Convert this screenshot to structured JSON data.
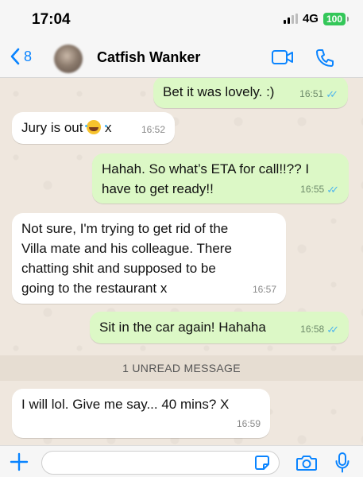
{
  "status_bar": {
    "time": "17:04",
    "network": "4G",
    "battery": "100"
  },
  "header": {
    "back_count": "8",
    "contact_name": "Catfish Wanker"
  },
  "messages": [
    {
      "direction": "out",
      "text": "Bet it was lovely. :)",
      "time": "16:51",
      "read": true
    },
    {
      "direction": "in",
      "text": "Jury is out",
      "emoji": "laughing-emoji",
      "suffix": "x",
      "time": "16:52"
    },
    {
      "direction": "out",
      "lines": [
        "Hahah. So what’s ETA for call!!?? I",
        "have to get ready!!"
      ],
      "time": "16:55",
      "read": true
    },
    {
      "direction": "in",
      "lines": [
        "Not sure, I'm trying to get rid of the",
        "Villa mate and his colleague. There",
        "chatting shit and supposed to be",
        "going to the restaurant x"
      ],
      "time": "16:57"
    },
    {
      "direction": "out",
      "text": "Sit in the car again! Hahaha",
      "time": "16:58",
      "read": true
    },
    {
      "direction": "in",
      "text": "I will lol. Give me say... 40 mins? X",
      "time": "16:59"
    }
  ],
  "unread_label": "1 UNREAD MESSAGE",
  "composer": {
    "value": "",
    "placeholder": ""
  },
  "colors": {
    "accent": "#0a84ff",
    "outgoing_bubble": "#dcf8c6",
    "incoming_bubble": "#ffffff",
    "read_ticks": "#4fb6ec",
    "battery": "#34c759"
  },
  "icons": [
    "back-chevron-icon",
    "video-call-icon",
    "phone-icon",
    "plus-icon",
    "sticker-icon",
    "camera-icon",
    "microphone-icon"
  ]
}
